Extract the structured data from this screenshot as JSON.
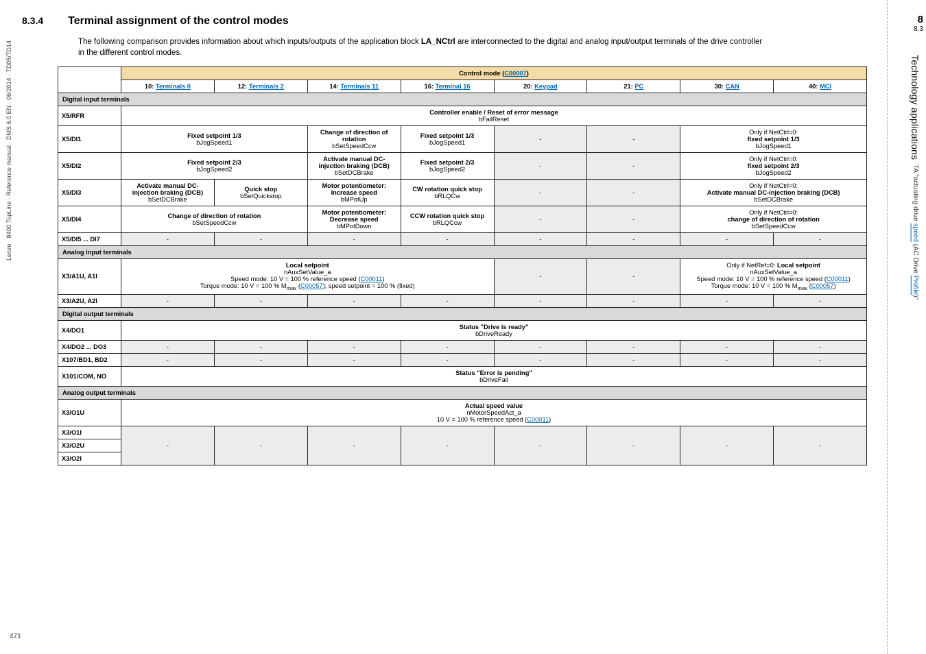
{
  "section_num": "8.3.4",
  "section_title": "Terminal assignment of the control modes",
  "intro_a": "The following comparison provides information about which inputs/outputs of the application block ",
  "intro_bold": "LA_NCtrl",
  "intro_b": " are interconnected to the digital and analog input/output terminals of the drive controller in the different control modes.",
  "control_mode_label": "Control mode (",
  "control_mode_link": "C00007",
  "control_mode_close": ")",
  "cols": {
    "c10a": "10: ",
    "c10": "Terminals 0",
    "c12a": "12: ",
    "c12": "Terminals 2",
    "c14a": "14: ",
    "c14": "Terminals 11",
    "c16a": "16: ",
    "c16": "Terminal 16",
    "c20a": "20: ",
    "c20": "Keypad",
    "c21a": "21: ",
    "c21": "PC",
    "c30a": "30: ",
    "c30": "CAN",
    "c40a": "40: ",
    "c40": "MCI"
  },
  "hdr_digital_in": "Digital input terminals",
  "x5rfr": "X5/RFR",
  "x5rfr_txt_a": "Controller enable / Reset of error message",
  "x5rfr_txt_b": "bFailReset",
  "x5di1": "X5/DI1",
  "x5di1_a": "Fixed setpoint 1/3",
  "x5di1_a2": "bJogSpeed1",
  "x5di1_b": "Change of direction of",
  "x5di1_b2": "rotation",
  "x5di1_b3": "bSetSpeedCcw",
  "x5di1_c": "Fixed setpoint 1/3",
  "x5di1_c2": "bJogSpeed1",
  "x5di1_r": "Only if NetCtrl=0:",
  "x5di1_r2": "fixed setpoint 1/3",
  "x5di1_r3": "bJogSpeed1",
  "x5di2": "X5/DI2",
  "x5di2_a": "Fixed setpoint 2/3",
  "x5di2_a2": "bJogSpeed2",
  "x5di2_b": "Activate manual DC-",
  "x5di2_b2": "injection braking (DCB)",
  "x5di2_b3": "bSetDCBrake",
  "x5di2_c": "Fixed setpoint 2/3",
  "x5di2_c2": "bJogSpeed2",
  "x5di2_r": "Only if NetCtrl=0:",
  "x5di2_r2": "fixed setpoint 2/3",
  "x5di2_r3": "bJogSpeed2",
  "x5di3": "X5/DI3",
  "x5di3_a1": "Activate manual DC-",
  "x5di3_a2": "injection braking (DCB)",
  "x5di3_a3": "bSetDCBrake",
  "x5di3_b1": "Quick stop",
  "x5di3_b2": "bSetQuickstop",
  "x5di3_c1": "Motor potentiometer:",
  "x5di3_c2": "Increase speed",
  "x5di3_c3": "bMPotUp",
  "x5di3_d1": "CW rotation quick stop",
  "x5di3_d2": "bRLQCw",
  "x5di3_r": "Only if NetCtrl=0:",
  "x5di3_r2": "Activate manual DC-injection braking (DCB)",
  "x5di3_r3": "bSetDCBrake",
  "x5di4": "X5/DI4",
  "x5di4_a": "Change of direction of rotation",
  "x5di4_a2": "bSetSpeedCcw",
  "x5di4_b1": "Motor potentiometer:",
  "x5di4_b2": "Decrease speed",
  "x5di4_b3": "bMPotDown",
  "x5di4_c1": "CCW rotation quick stop",
  "x5di4_c2": "bRLQCcw",
  "x5di4_r": "Only if NetCtrl=0:",
  "x5di4_r2": "change of direction of rotation",
  "x5di4_r3": "bSetSpeedCcw",
  "x5di5": "X5/DI5 ... DI7",
  "hdr_analog_in": "Analog input terminals",
  "x3a1u": "X3/A1U, A1I",
  "x3a1u_1": "Local setpoint",
  "x3a1u_2": "nAuxSetValue_a",
  "x3a1u_3a": "Speed mode: 10 V = 100 % reference speed (",
  "x3a1u_3l": "C00011",
  "x3a1u_3b": ")",
  "x3a1u_4a": "Torque mode: 10 V = 100 % M",
  "x3a1u_4s": "max",
  "x3a1u_4b": " (",
  "x3a1u_4l": "C00057",
  "x3a1u_4c": "); speed setpoint = 100 % (fixed)",
  "x3a1u_r1": "Only if NetRef=0: ",
  "x3a1u_r1b": "Local setpoint",
  "x3a1u_r2": "nAuxSetValue_a",
  "x3a1u_r3a": "Speed mode: 10 V = 100 % reference speed (",
  "x3a1u_r3l": "C00011",
  "x3a1u_r3b": ")",
  "x3a1u_r4a": "Torque mode: 10 V = 100 % M",
  "x3a1u_r4s": "max",
  "x3a1u_r4b": " (",
  "x3a1u_r4l": "C00057",
  "x3a1u_r4c": ")",
  "x3a2u": "X3/A2U, A2I",
  "hdr_digital_out": "Digital output terminals",
  "x4do1": "X4/DO1",
  "x4do1_a": "Status \"Drive is ready\"",
  "x4do1_b": "bDriveReady",
  "x4do2": "X4/DO2 ... DO3",
  "x107": "X107/BD1, BD2",
  "x101": "X101/COM, NO",
  "x101_a": "Status \"Error is pending\"",
  "x101_b": "bDriveFail",
  "hdr_analog_out": "Analog output terminals",
  "x3o1u": "X3/O1U",
  "x3o1u_a": "Actual speed value",
  "x3o1u_b": "nMotorSpeedAct_a",
  "x3o1u_c_a": "10 V = 100 % reference speed (",
  "x3o1u_c_l": "C00011",
  "x3o1u_c_b": ")",
  "x3o1i": "X3/O1I",
  "x3o2u": "X3/O2U",
  "x3o2i": "X3/O2I",
  "side_text": "Lenze · 8400 TopLine · Reference manual · DMS 6.0 EN · 06/2014 · TD05/TD14",
  "page_num": "471",
  "rail_big": "8",
  "rail_sub": "8.3",
  "rail_title": "Technology applications",
  "rail_desc_a": "TA \"actuating drive ",
  "rail_desc_l": "speed",
  "rail_desc_b": " (AC Drive ",
  "rail_desc_l2": "Profile",
  "rail_desc_c": ")\""
}
